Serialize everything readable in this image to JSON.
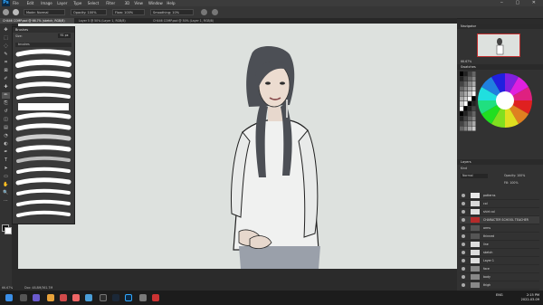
{
  "app": {
    "logo": "Ps"
  },
  "menu": [
    "File",
    "Edit",
    "Image",
    "Layer",
    "Type",
    "Select",
    "Filter",
    "3D",
    "View",
    "Window",
    "Help"
  ],
  "options": {
    "mode_label": "Mode:",
    "mode_value": "Normal",
    "opacity_label": "Opacity:",
    "opacity_value": "100%",
    "flow_label": "Flow:",
    "flow_value": "100%",
    "smoothing_label": "Smoothing:",
    "smoothing_value": "10%"
  },
  "tabs": [
    "CH446 COMP.psd @ 66.7% (sketch, RGB/8)",
    "Layer 5 @ 50% (Layer 1, RGB/8)",
    "CH446 COMP.psd @ 50% (Layer 1, RGB/8)"
  ],
  "brushes": {
    "title": "Brushes",
    "size_label": "Size:",
    "size_value": "91 px",
    "group": "brushes"
  },
  "tools": [
    "move-tool",
    "marquee-tool",
    "lasso-tool",
    "quick-select-tool",
    "crop-tool",
    "frame-tool",
    "eyedropper-tool",
    "healing-tool",
    "brush-tool",
    "stamp-tool",
    "history-brush-tool",
    "eraser-tool",
    "gradient-tool",
    "blur-tool",
    "dodge-tool",
    "pen-tool",
    "type-tool",
    "path-select-tool",
    "shape-tool",
    "hand-tool",
    "zoom-tool",
    "more-tools"
  ],
  "tool_glyphs": [
    "✥",
    "⬚",
    "◌",
    "✎",
    "⌗",
    "⊠",
    "✐",
    "✚",
    "✏",
    "⎘",
    "↺",
    "◫",
    "▤",
    "◔",
    "◐",
    "✒",
    "T",
    "➤",
    "▭",
    "✋",
    "🔍",
    "⋯"
  ],
  "status": {
    "zoom": "66.67%",
    "doc": "Doc: 48.8M/361.7M"
  },
  "navigator": {
    "title": "Navigator",
    "zoom": "66.67%"
  },
  "swatches": {
    "title": "Swatches"
  },
  "layers": {
    "title": "Layers",
    "kind": "Kind",
    "blend": "Normal",
    "opacity_label": "Opacity:",
    "opacity_value": "100%",
    "fill_label": "Fill:",
    "fill_value": "100%",
    "rows": [
      {
        "name": "patterns",
        "color": "#e8e8e8"
      },
      {
        "name": "col",
        "color": "#d8d8d8"
      },
      {
        "name": "shirt col",
        "color": "#e0e0e0"
      },
      {
        "name": "CHARACTER SCHOOL TEACHER",
        "color": "#b52a2a"
      },
      {
        "name": "arms",
        "color": "#555"
      },
      {
        "name": "thinned",
        "color": "#555"
      },
      {
        "name": "line",
        "color": "#ddd"
      },
      {
        "name": "sketch",
        "color": "#ddd"
      },
      {
        "name": "Layer 1",
        "color": "#ddd"
      },
      {
        "name": "face",
        "color": "#888"
      },
      {
        "name": "body",
        "color": "#888"
      },
      {
        "name": "thigh",
        "color": "#888"
      }
    ]
  },
  "taskbar": {
    "time": "2:15 PM",
    "date": "2022-03-09",
    "lang": "ENG"
  },
  "colors": {
    "menubar": "#3c3c3c",
    "panel": "#323232",
    "canvas_bg": "#dde1de",
    "accent": "#31a8ff",
    "layer_selected": "#b52a2a"
  }
}
